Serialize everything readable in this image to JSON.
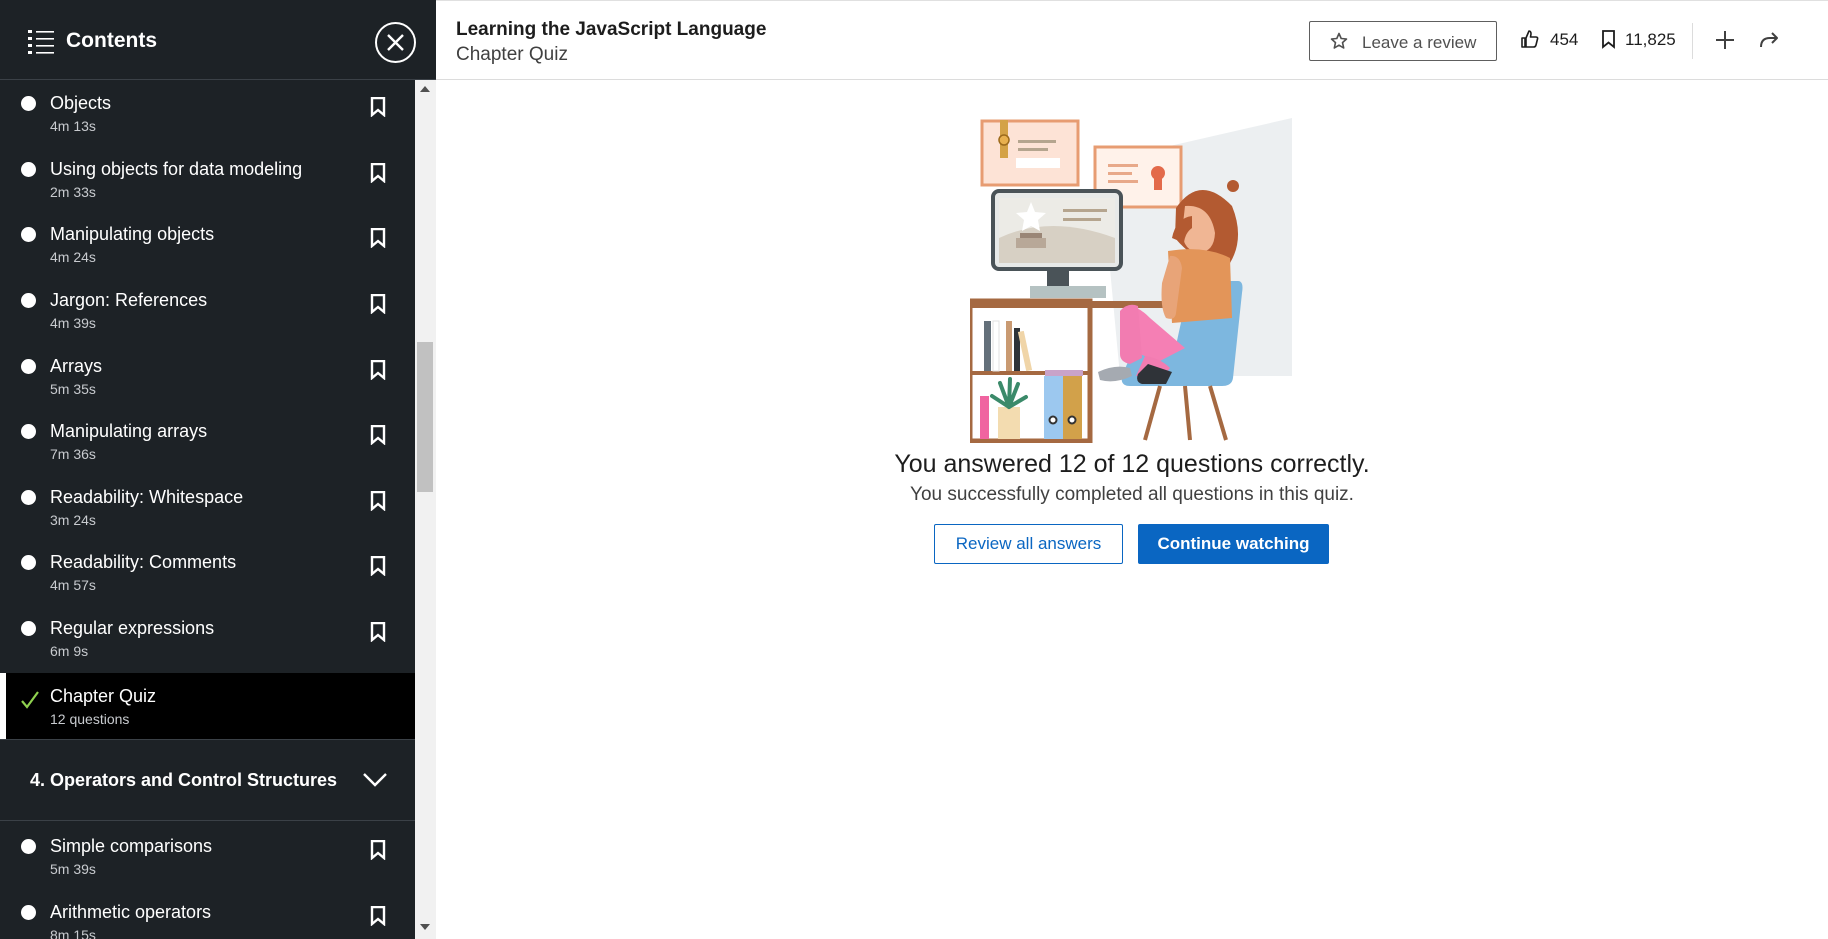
{
  "sidebar": {
    "title": "Contents",
    "items": [
      {
        "title": "Objects",
        "duration": "4m 13s"
      },
      {
        "title": "Using objects for data modeling",
        "duration": "2m 33s"
      },
      {
        "title": "Manipulating objects",
        "duration": "4m 24s"
      },
      {
        "title": "Jargon: References",
        "duration": "4m 39s"
      },
      {
        "title": "Arrays",
        "duration": "5m 35s"
      },
      {
        "title": "Manipulating arrays",
        "duration": "7m 36s"
      },
      {
        "title": "Readability: Whitespace",
        "duration": "3m 24s"
      },
      {
        "title": "Readability: Comments",
        "duration": "4m 57s"
      },
      {
        "title": "Regular expressions",
        "duration": "6m 9s"
      },
      {
        "title": "Chapter Quiz",
        "duration": "12 questions",
        "status": "completed",
        "active": true
      }
    ],
    "section": {
      "title": "4. Operators and Control Structures"
    },
    "section_items": [
      {
        "title": "Simple comparisons",
        "duration": "5m 39s"
      },
      {
        "title": "Arithmetic operators",
        "duration": "8m 15s"
      }
    ]
  },
  "header": {
    "course_title": "Learning the JavaScript Language",
    "subtitle": "Chapter Quiz",
    "review_label": "Leave a review",
    "likes": "454",
    "saves": "11,825"
  },
  "main": {
    "result_title": "You answered 12 of 12 questions correctly.",
    "result_subtitle": "You successfully completed all questions in this quiz.",
    "review_button": "Review all answers",
    "continue_button": "Continue watching"
  },
  "colors": {
    "sidebar_bg": "#1d2226",
    "accent_blue": "#0a66c2",
    "check_green": "#8fd14f"
  },
  "icons": [
    "list-icon",
    "close-icon",
    "bookmark-icon",
    "check-icon",
    "chevron-down-icon",
    "star-icon",
    "like-icon",
    "plus-icon",
    "share-icon"
  ]
}
